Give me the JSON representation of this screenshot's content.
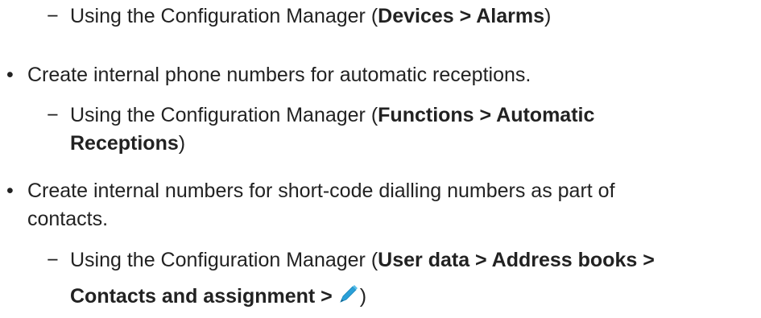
{
  "bullet_symbol": "•",
  "dash_symbol": "−",
  "sub1": {
    "prefix": "Using the Configuration Manager (",
    "bold": "Devices > Alarms",
    "suffix": ")"
  },
  "item2": {
    "text": "Create internal phone numbers for automatic receptions."
  },
  "sub2": {
    "prefix": "Using the Configuration Manager (",
    "bold_line1": "Functions > Automatic",
    "bold_line2": "Receptions",
    "suffix": ")"
  },
  "item3": {
    "text_line1": "Create internal numbers for short-code dialling numbers as part of",
    "text_line2": "contacts."
  },
  "sub3": {
    "prefix": "Using the Configuration Manager (",
    "bold_line1": "User data > Address books >",
    "bold_line2": "Contacts and assignment >",
    "suffix": ")",
    "icon": "pencil-icon",
    "icon_color": "#2aa0d8"
  }
}
